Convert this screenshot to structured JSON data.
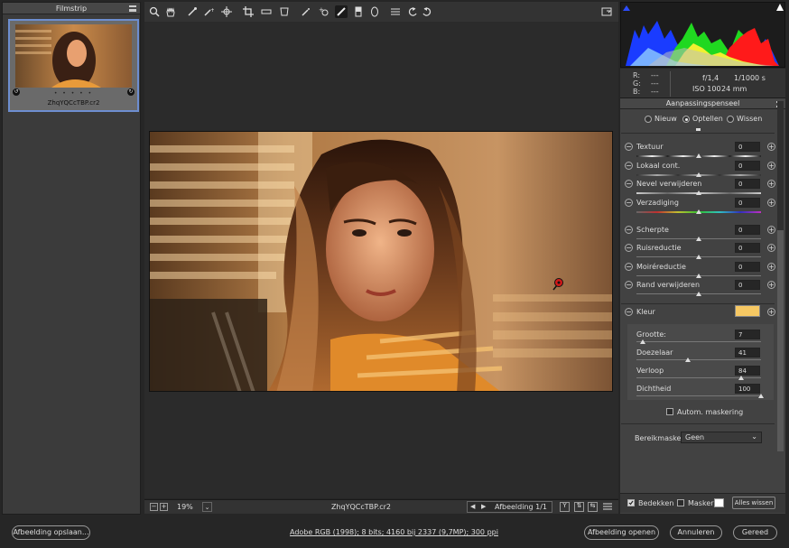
{
  "filmstrip": {
    "title": "Filmstrip",
    "file_name": "ZhqYQCcTBP.cr2",
    "stars": "• • • • •"
  },
  "status": {
    "zoom": "19%",
    "file_name": "ZhqYQCcTBP.cr2",
    "image_counter": "Afbeelding 1/1"
  },
  "metadata": {
    "r_label": "R:",
    "g_label": "G:",
    "b_label": "B:",
    "r": "---",
    "g": "---",
    "b": "---",
    "aperture": "f/1,4",
    "shutter": "1/1000 s",
    "iso": "ISO 100",
    "focal": "24 mm"
  },
  "panel": {
    "title": "Aanpassingspenseel",
    "modes": [
      {
        "label": "Nieuw",
        "selected": false
      },
      {
        "label": "Optellen",
        "selected": true
      },
      {
        "label": "Wissen",
        "selected": false
      }
    ],
    "sliders": [
      {
        "label": "Textuur",
        "value": "0"
      },
      {
        "label": "Lokaal cont.",
        "value": "0"
      },
      {
        "label": "Nevel verwijderen",
        "value": "0"
      },
      {
        "label": "Verzadiging",
        "value": "0"
      },
      {
        "label": "Scherpte",
        "value": "0"
      },
      {
        "label": "Ruisreductie",
        "value": "0"
      },
      {
        "label": "Moiréreductie",
        "value": "0"
      },
      {
        "label": "Rand verwijderen",
        "value": "0"
      }
    ],
    "color_label": "Kleur",
    "color_value": "#f6c863",
    "brush": [
      {
        "label": "Grootte:",
        "value": "7",
        "level": 0.05
      },
      {
        "label": "Doezelaar",
        "value": "41",
        "level": 0.41
      },
      {
        "label": "Verloop",
        "value": "84",
        "level": 0.84
      },
      {
        "label": "Dichtheid",
        "value": "100",
        "level": 1.0
      }
    ],
    "auto_mask_label": "Autom. maskering",
    "range_mask_label": "Bereikmasker:",
    "range_mask_value": "Geen",
    "overlay_label": "Bedekken",
    "mask_label": "Masker",
    "clear_all_label": "Alles wissen"
  },
  "footer": {
    "save_label": "Afbeelding opslaan...",
    "color_info": "Adobe RGB (1998); 8 bits; 4160 bij 2337 (9,7MP); 300 ppi",
    "open_label": "Afbeelding openen",
    "cancel_label": "Annuleren",
    "done_label": "Gereed"
  },
  "colors": {
    "accent": "#6d8ed0",
    "swatch": "#f6c863",
    "pin": "#d21818"
  }
}
